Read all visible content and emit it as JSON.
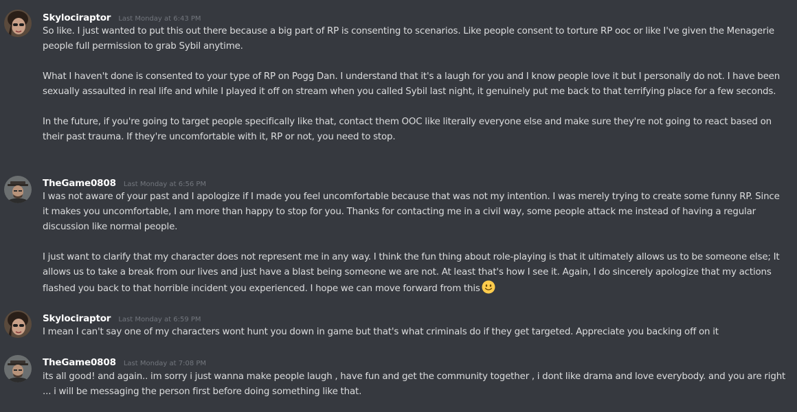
{
  "messages": [
    {
      "username": "Skylociraptor",
      "timestamp": "Last Monday at 6:43 PM",
      "avatar_icon": "skylociraptor-avatar",
      "paragraphs": [
        "So like. I just wanted to put this out there because a big part of RP is consenting to scenarios. Like people consent to torture RP ooc or like I've given the Menagerie people full permission to grab Sybil anytime.",
        "What I haven't done is consented to your type of RP on Pogg Dan. I understand that it's a laugh for you and I know people love it but I personally do not. I have been sexually assaulted in real life and while I played it off on stream when you called Sybil last night, it genuinely put me back to that terrifying place for a few seconds.",
        "In the future, if you're going to target people specifically like that, contact them OOC like literally everyone else and make sure they're not going to react based on their past trauma. If they're uncomfortable with it, RP or not, you need to stop."
      ]
    },
    {
      "username": "TheGame0808",
      "timestamp": "Last Monday at 6:56 PM",
      "avatar_icon": "thegame0808-avatar",
      "paragraphs": [
        "I was not aware of your past and I apologize if I made you feel uncomfortable because that was not my intention. I was merely trying to create some funny RP. Since it makes you uncomfortable, I am more than happy to stop for you. Thanks for contacting me in a civil way, some people attack me instead of having a regular discussion like normal people.",
        "I just want to clarify that my character does not represent me in any way. I think the fun thing about role-playing is that it ultimately allows us to be someone else; It allows us to take a break from our lives and just have a blast being someone we are not. At least that's how I see it. Again, I do sincerely apologize that my actions flashed you back to that horrible incident you experienced. I hope we can move forward from this"
      ],
      "trailing_emoji": "slightly-smiling-face-emoji"
    },
    {
      "username": "Skylociraptor",
      "timestamp": "Last Monday at 6:59 PM",
      "avatar_icon": "skylociraptor-avatar",
      "paragraphs": [
        "I mean I can't say one of my characters wont hunt you down in game but that's what criminals do if they get targeted. Appreciate you backing off on it"
      ]
    },
    {
      "username": "TheGame0808",
      "timestamp": "Last Monday at 7:08 PM",
      "avatar_icon": "thegame0808-avatar",
      "paragraphs": [
        "its all good! and again.. im sorry i just wanna make people laugh , have fun and get the community together , i dont like drama and love everybody. and you are right ... i will be messaging the person first before doing something like that."
      ]
    }
  ],
  "colors": {
    "background": "#36393f",
    "username": "#ffffff",
    "timestamp": "#72767d",
    "text": "#dcddde",
    "emoji": "#ffcc4d"
  }
}
